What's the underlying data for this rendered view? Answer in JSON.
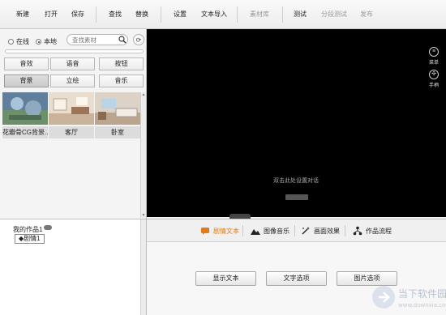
{
  "toolbar": {
    "new": "新建",
    "open": "打开",
    "save": "保存",
    "find": "查找",
    "replace": "替换",
    "settings": "设置",
    "text_import": "文本导入",
    "asset_library": "素材库",
    "test": "测试",
    "segment_test": "分段测试",
    "publish": "发布"
  },
  "assets": {
    "source_online": "在线",
    "source_local": "本地",
    "search_placeholder": "查找素材",
    "categories": [
      "音效",
      "语音",
      "按钮",
      "背景",
      "立绘",
      "音乐"
    ],
    "active_category": "背景",
    "thumbnails": [
      "花瓣骨CG背景...",
      "客厅",
      "卧室"
    ]
  },
  "preview": {
    "side_icons": [
      "菜单",
      "手柄"
    ],
    "hint": "双击此处设置对话"
  },
  "project": {
    "title": "我的作品1",
    "scene": "◆剧情1"
  },
  "panel": {
    "tabs": [
      "剧情文本",
      "图像音乐",
      "画面效果",
      "作品流程"
    ],
    "active_tab": "剧情文本",
    "buttons": [
      "显示文本",
      "文字选项",
      "图片选项"
    ]
  },
  "watermark": {
    "name": "当下软件园",
    "url": "www.downxia.com"
  },
  "colors": {
    "accent": "#e07b1a",
    "preview_bg": "#000000"
  }
}
